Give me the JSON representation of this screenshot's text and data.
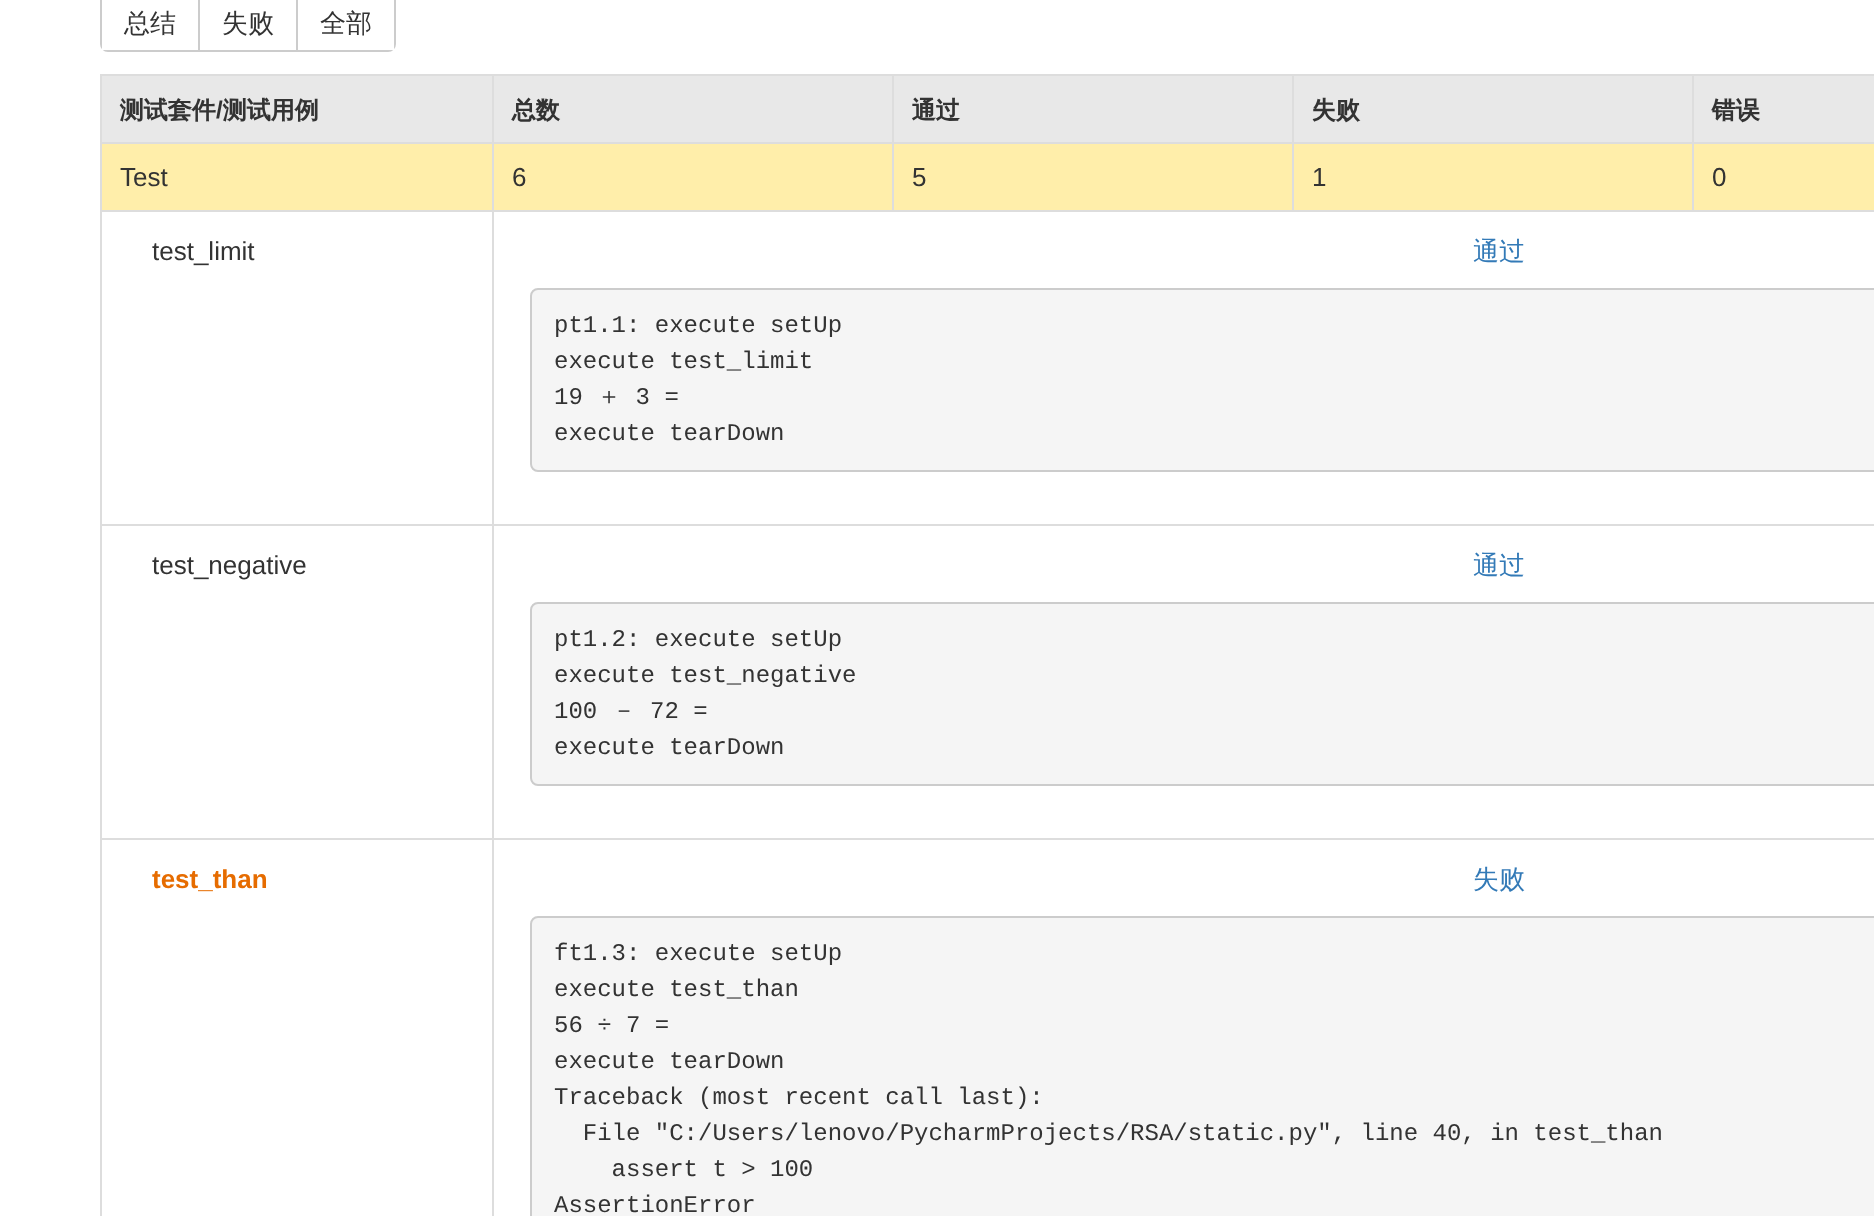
{
  "filter_buttons": [
    {
      "label": "总结"
    },
    {
      "label": "失败"
    },
    {
      "label": "全部"
    }
  ],
  "table": {
    "columns": [
      "测试套件/测试用例",
      "总数",
      "通过",
      "失败",
      "错误"
    ],
    "suite_row": {
      "name": "Test",
      "total": "6",
      "passed": "5",
      "failed": "1",
      "errors": "0"
    },
    "cases": [
      {
        "name": "test_limit",
        "kind": "pass",
        "status": "通过",
        "output": [
          "pt1.1: execute setUp",
          "execute test_limit",
          "19 ＋ 3 =",
          "execute tearDown"
        ]
      },
      {
        "name": "test_negative",
        "kind": "pass",
        "status": "通过",
        "output": [
          "pt1.2: execute setUp",
          "execute test_negative",
          "100 － 72 =",
          "execute tearDown"
        ]
      },
      {
        "name": "test_than",
        "kind": "fail",
        "status": "失败",
        "output": [
          "ft1.3: execute setUp",
          "execute test_than",
          "56 ÷ 7 =",
          "execute tearDown",
          "Traceback (most recent call last):",
          "  File \"C:/Users/lenovo/PycharmProjects/RSA/static.py\", line 40, in test_than",
          "    assert t > 100",
          "AssertionError"
        ]
      }
    ]
  }
}
